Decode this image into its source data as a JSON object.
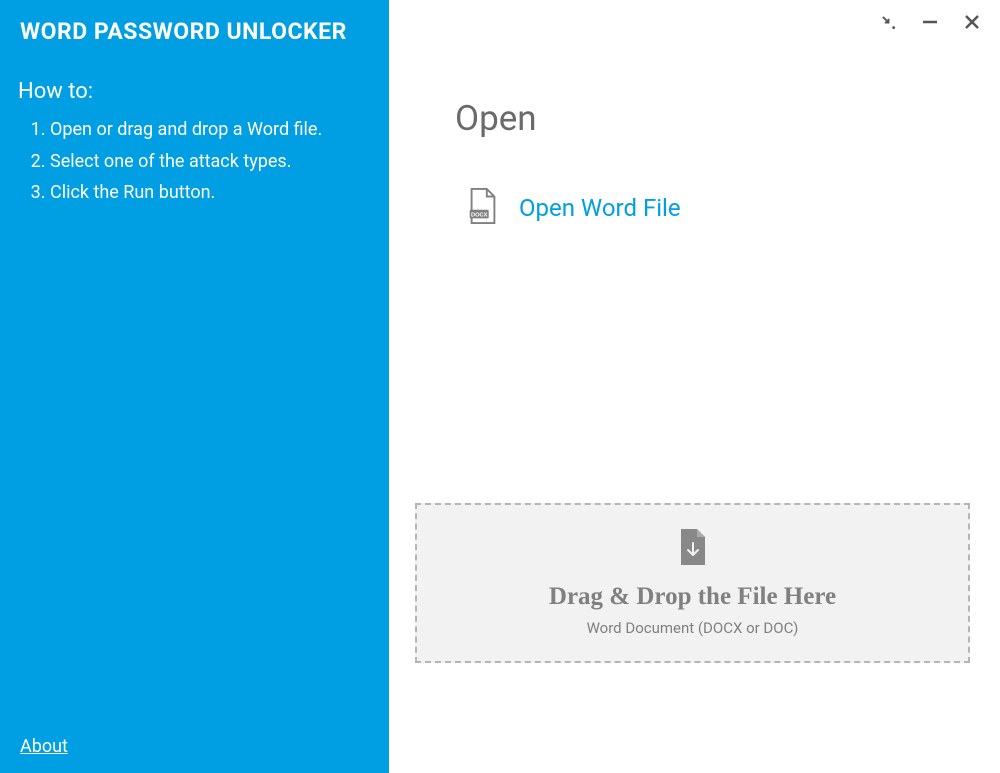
{
  "sidebar": {
    "app_title": "WORD PASSWORD UNLOCKER",
    "howto_title": "How to:",
    "steps": [
      "Open or drag and drop a Word file.",
      "Select one of the attack types.",
      "Click the Run button."
    ],
    "about_label": "About"
  },
  "main": {
    "open_heading": "Open",
    "open_link_label": "Open Word File",
    "docx_badge": "DOCX",
    "dropzone": {
      "title": "Drag & Drop the File Here",
      "subtitle": "Word Document (DOCX or DOC)"
    }
  },
  "colors": {
    "accent": "#009fe3"
  }
}
